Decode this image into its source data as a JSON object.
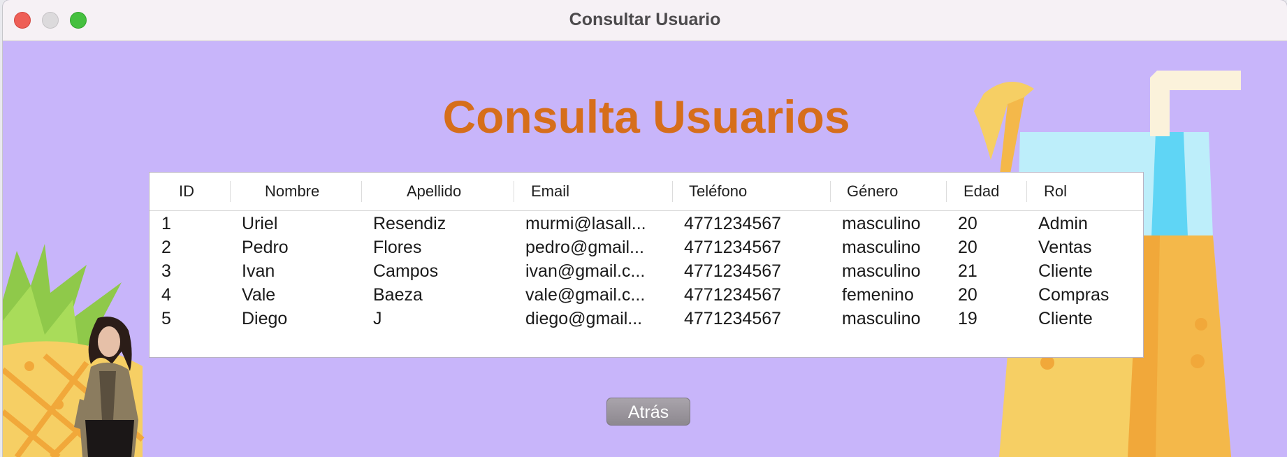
{
  "window": {
    "title": "Consultar Usuario"
  },
  "page": {
    "heading": "Consulta Usuarios"
  },
  "table": {
    "columns": [
      "ID",
      "Nombre",
      "Apellido",
      "Email",
      "Teléfono",
      "Género",
      "Edad",
      "Rol"
    ],
    "rows": [
      [
        "1",
        "Uriel",
        "Resendiz",
        "murmi@lasall...",
        "4771234567",
        "masculino",
        "20",
        "Admin"
      ],
      [
        "2",
        "Pedro",
        "Flores",
        "pedro@gmail...",
        "4771234567",
        "masculino",
        "20",
        "Ventas"
      ],
      [
        "3",
        "Ivan",
        "Campos",
        "ivan@gmail.c...",
        "4771234567",
        "masculino",
        "21",
        "Cliente"
      ],
      [
        "4",
        "Vale",
        "Baeza",
        "vale@gmail.c...",
        "4771234567",
        "femenino",
        "20",
        "Compras"
      ],
      [
        "5",
        "Diego",
        "J",
        "diego@gmail...",
        "4771234567",
        "masculino",
        "19",
        "Cliente"
      ]
    ]
  },
  "buttons": {
    "back_label": "Atrás"
  },
  "colors": {
    "background": "#c8b5fa",
    "heading": "#d66e1b",
    "pineapple_leaves": "#8fc94a",
    "pineapple_body": "#f6cf64",
    "juice": "#f4b84a",
    "glass_top": "#a7e6f7",
    "straw": "#fbf2db"
  },
  "icons": {
    "pineapple": "pineapple-illustration",
    "juice": "juice-glass-illustration",
    "person": "person-photo"
  }
}
